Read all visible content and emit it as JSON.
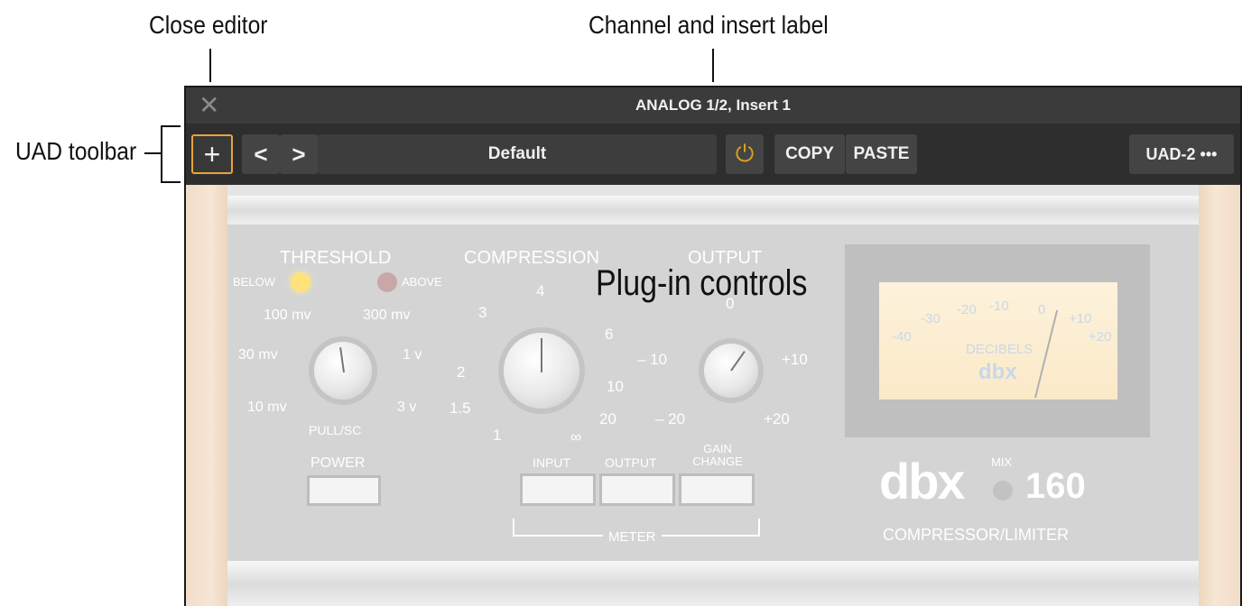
{
  "callouts": {
    "close_editor": "Close editor",
    "channel_label": "Channel and insert label",
    "uad_toolbar": "UAD toolbar",
    "plugin_controls": "Plug-in controls"
  },
  "window": {
    "title": "ANALOG 1/2, Insert 1",
    "close_glyph": "✕"
  },
  "toolbar": {
    "add_glyph": "+",
    "prev_glyph": "<",
    "next_glyph": ">",
    "preset": "Default",
    "power_glyph": "⏻",
    "copy": "COPY",
    "paste": "PASTE",
    "uad_menu": "UAD-2 •••"
  },
  "plugin": {
    "threshold": "THRESHOLD",
    "below": "BELOW",
    "above": "ABOVE",
    "compression": "COMPRESSION",
    "output": "OUTPUT",
    "thr_100mv": "100 mv",
    "thr_300mv": "300 mv",
    "thr_30mv": "30 mv",
    "thr_1v": "1 v",
    "thr_10mv": "10 mv",
    "thr_3v": "3 v",
    "pull_sc": "PULL/SC",
    "c_4": "4",
    "c_3": "3",
    "c_6": "6",
    "c_2": "2",
    "c_10": "10",
    "c_15": "1.5",
    "c_20": "20",
    "c_1": "1",
    "c_inf": "∞",
    "o_0": "0",
    "o_m10": "– 10",
    "o_p10": "+10",
    "o_m20": "– 20",
    "o_p20": "+20",
    "power": "POWER",
    "input": "INPUT",
    "meter_output": "OUTPUT",
    "gain_change": "GAIN CHANGE",
    "meter": "METER",
    "vu_m40": "-40",
    "vu_m30": "-30",
    "vu_m20": "-20",
    "vu_m10": "-10",
    "vu_0": "0",
    "vu_p10": "+10",
    "vu_p20": "+20",
    "decibels": "DECIBELS",
    "vu_brand": "dbx",
    "brand": "dbx",
    "mix": "MIX",
    "model": "160",
    "type": "COMPRESSOR/LIMITER"
  },
  "colors": {
    "accent_orange": "#e8a33b",
    "power_yellow": "#d9a020",
    "led_below": "#ffe27a",
    "led_above": "#c9a7a7"
  }
}
